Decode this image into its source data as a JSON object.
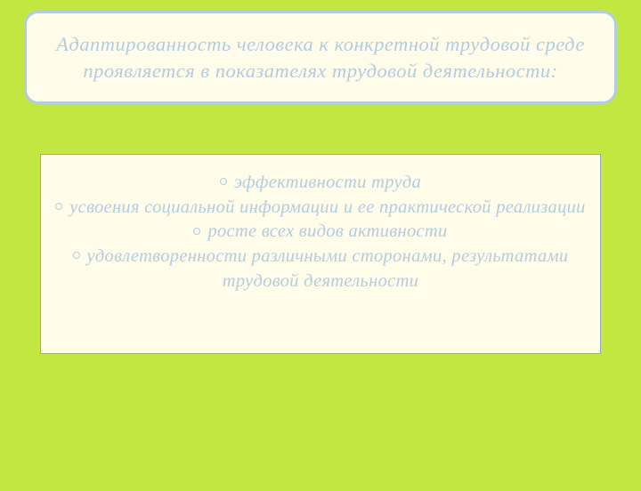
{
  "header": {
    "text": "Адаптированность человека к конкретной трудовой среде проявляется в показателях трудовой деятельности:"
  },
  "content": {
    "items": [
      "эффективности труда",
      "усвоения социальной информации и ее практической реализации",
      "росте всех видов активности",
      "удовлетворенности различными сторонами, результатами трудовой деятельности"
    ]
  }
}
